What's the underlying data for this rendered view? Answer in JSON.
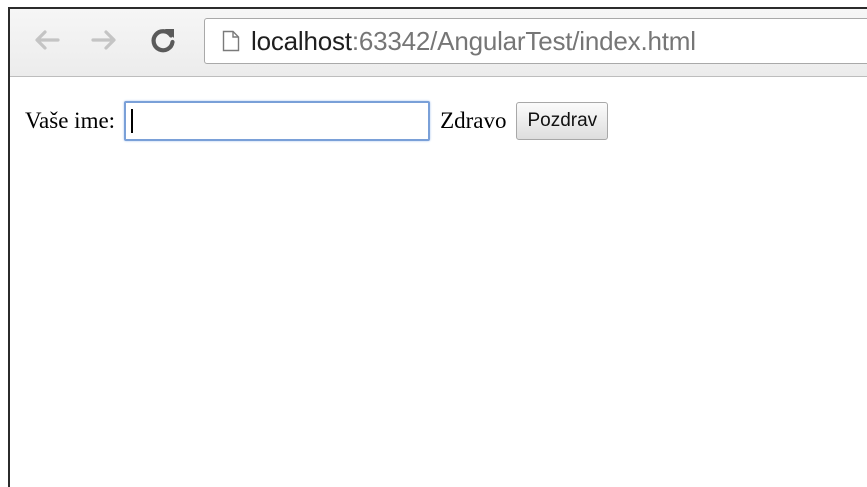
{
  "browser": {
    "url_host": "localhost",
    "url_rest": ":63342/AngularTest/index.html",
    "icons": {
      "back": "arrow-left-icon",
      "forward": "arrow-right-icon",
      "reload": "reload-icon",
      "page": "page-icon"
    }
  },
  "form": {
    "name_label": "Vaše ime:",
    "name_value": "",
    "greeting_text": "Zdravo",
    "greet_button_label": "Pozdrav"
  }
}
